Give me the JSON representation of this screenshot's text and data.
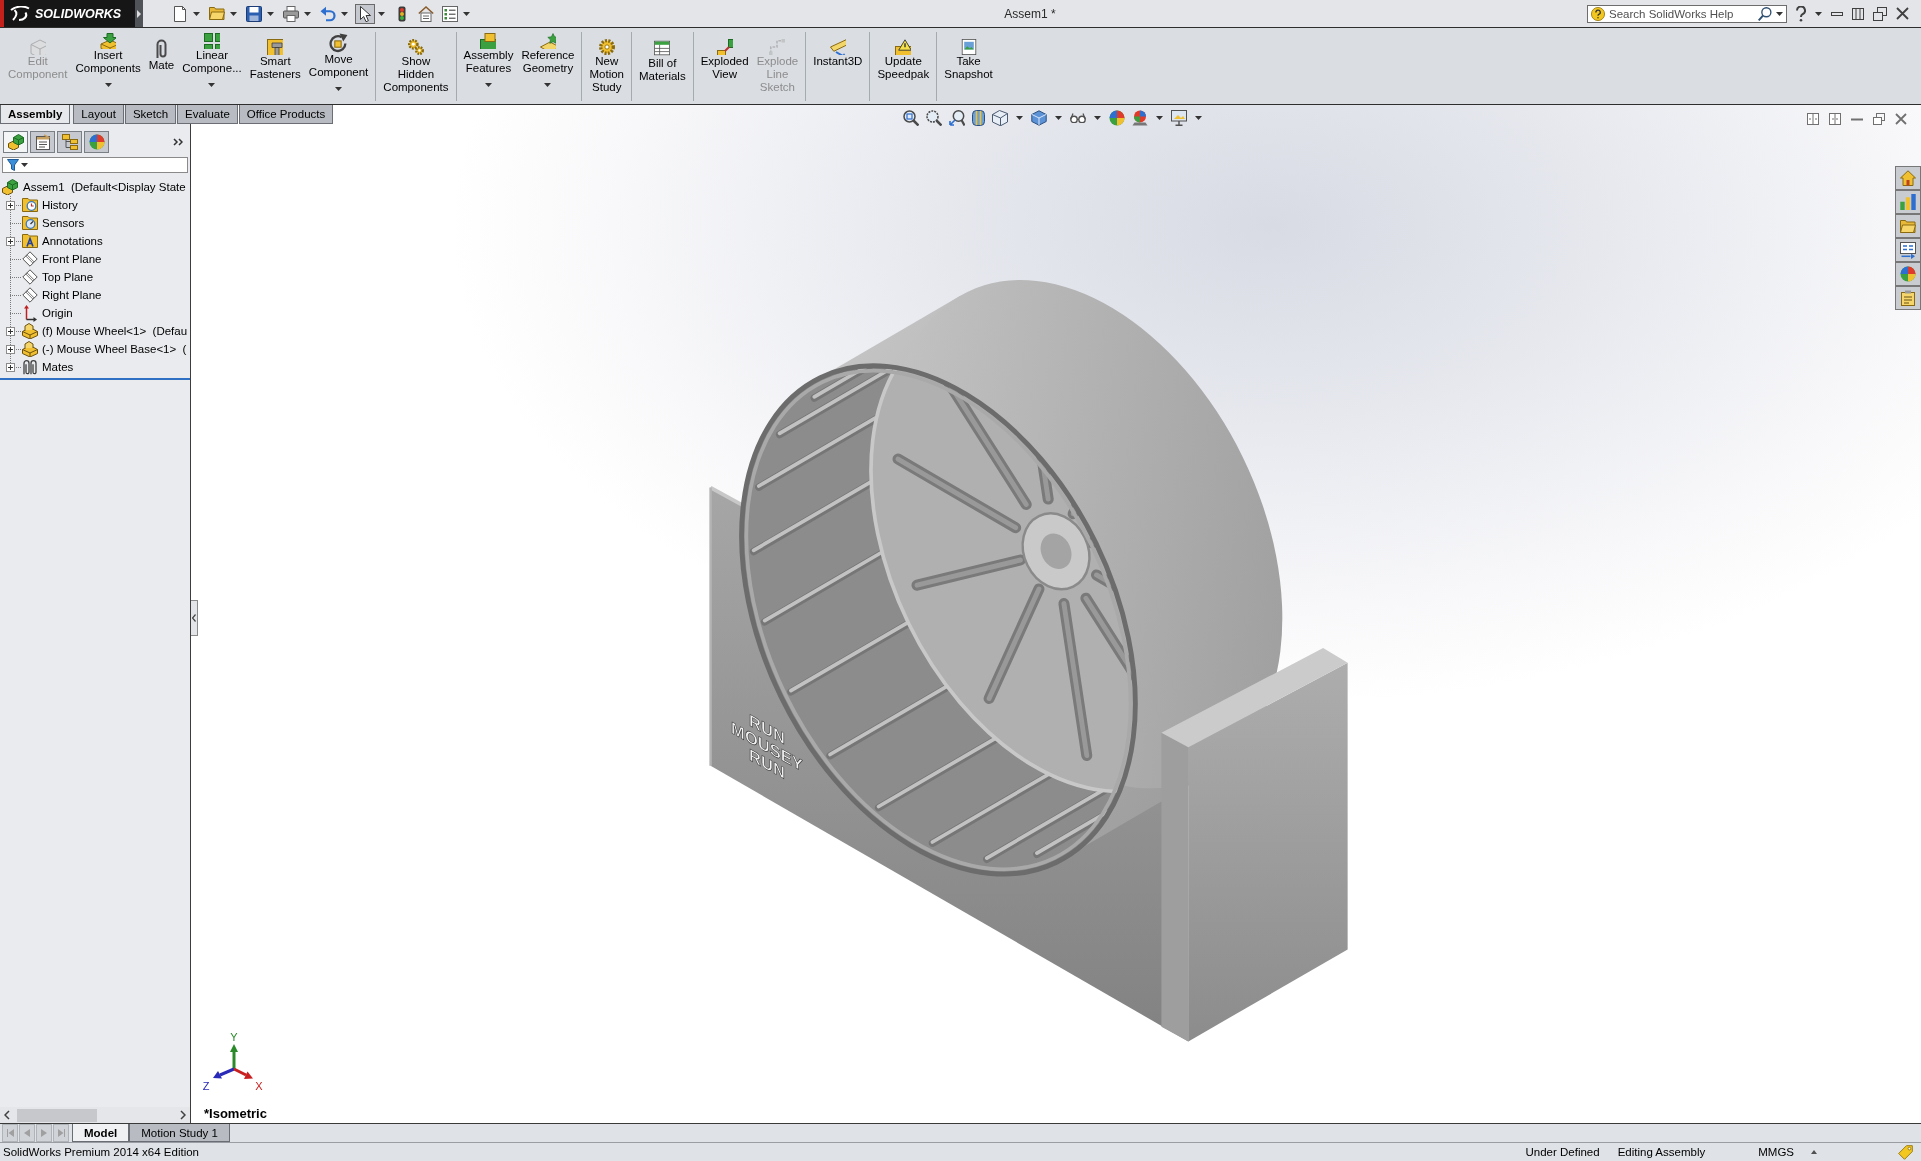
{
  "title_bar": {
    "logo": "SOLIDWORKS",
    "title": "Assem1 *",
    "search": {
      "placeholder": "Search SolidWorks Help"
    }
  },
  "quick_access": [
    {
      "pressed": false,
      "dropdown": true
    },
    {
      "pressed": false,
      "dropdown": true
    },
    {
      "pressed": false,
      "dropdown": true
    },
    {
      "pressed": false,
      "dropdown": true
    },
    {
      "pressed": false,
      "dropdown": true
    },
    {
      "pressed": true,
      "dropdown": true
    },
    {
      "pressed": false,
      "dropdown": false
    },
    {
      "pressed": false,
      "dropdown": false
    },
    {
      "pressed": false,
      "dropdown": true
    }
  ],
  "ribbon": {
    "groups": [
      [
        {
          "label": "Edit\nComponent",
          "disabled": true,
          "dropdown": false
        },
        {
          "label": "Insert\nComponents",
          "disabled": false,
          "dropdown": true
        },
        {
          "label": "Mate",
          "disabled": false,
          "dropdown": false
        },
        {
          "label": "Linear\nCompone...",
          "disabled": false,
          "dropdown": true
        },
        {
          "label": "Smart\nFasteners",
          "disabled": false,
          "dropdown": false
        },
        {
          "label": "Move\nComponent",
          "disabled": false,
          "dropdown": true
        }
      ],
      [
        {
          "label": "Show\nHidden\nComponents",
          "disabled": false,
          "dropdown": false
        }
      ],
      [
        {
          "label": "Assembly\nFeatures",
          "disabled": false,
          "dropdown": true
        },
        {
          "label": "Reference\nGeometry",
          "disabled": false,
          "dropdown": true
        }
      ],
      [
        {
          "label": "New\nMotion\nStudy",
          "disabled": false,
          "dropdown": false
        }
      ],
      [
        {
          "label": "Bill of\nMaterials",
          "disabled": false,
          "dropdown": false
        }
      ],
      [
        {
          "label": "Exploded\nView",
          "disabled": false,
          "dropdown": false
        },
        {
          "label": "Explode\nLine\nSketch",
          "disabled": true,
          "dropdown": false
        }
      ],
      [
        {
          "label": "Instant3D",
          "disabled": false,
          "dropdown": false
        }
      ],
      [
        {
          "label": "Update\nSpeedpak",
          "disabled": false,
          "dropdown": false
        }
      ],
      [
        {
          "label": "Take\nSnapshot",
          "disabled": false,
          "dropdown": false
        }
      ]
    ]
  },
  "ribbon_tabs": [
    {
      "label": "Assembly",
      "selected": true
    },
    {
      "label": "Layout",
      "selected": false
    },
    {
      "label": "Sketch",
      "selected": false
    },
    {
      "label": "Evaluate",
      "selected": false
    },
    {
      "label": "Office Products",
      "selected": false
    }
  ],
  "feature_manager": {
    "panel_tabs": [
      {
        "selected": true
      },
      {
        "selected": false
      },
      {
        "selected": false
      },
      {
        "selected": false
      }
    ],
    "tree": {
      "label": "Assem1  (Default<Display State",
      "children": [
        {
          "label": "History",
          "kind": "history",
          "expandable": true,
          "expanded": false
        },
        {
          "label": "Sensors",
          "kind": "sensors",
          "expandable": false
        },
        {
          "label": "Annotations",
          "kind": "annotations",
          "expandable": true,
          "expanded": false
        },
        {
          "label": "Front Plane",
          "kind": "plane",
          "expandable": false
        },
        {
          "label": "Top Plane",
          "kind": "plane",
          "expandable": false
        },
        {
          "label": "Right Plane",
          "kind": "plane",
          "expandable": false
        },
        {
          "label": "Origin",
          "kind": "origin",
          "expandable": false
        },
        {
          "label": "(f) Mouse Wheel<1>  (Defau",
          "kind": "component",
          "expandable": true,
          "expanded": false
        },
        {
          "label": "(-) Mouse Wheel Base<1>  (",
          "kind": "component",
          "expandable": true,
          "expanded": false
        },
        {
          "label": "Mates",
          "kind": "mates",
          "expandable": true,
          "expanded": false
        }
      ]
    }
  },
  "view_toolbar": [
    {
      "dropdown": false
    },
    {
      "dropdown": false
    },
    {
      "dropdown": false
    },
    {
      "dropdown": false
    },
    {
      "dropdown": true
    },
    {
      "dropdown": true
    },
    {
      "dropdown": true
    },
    {
      "dropdown": false
    },
    {
      "dropdown": true
    },
    {
      "dropdown": true
    }
  ],
  "viewport": {
    "engraving": "RUN\nMOUSEY\nRUN",
    "triad": {
      "y": "Y",
      "z": "Z",
      "x": "X"
    },
    "view_name": "*Isometric"
  },
  "bottom_tabs": [
    {
      "label": "Model",
      "selected": true
    },
    {
      "label": "Motion Study 1",
      "selected": false
    }
  ],
  "status_bar": {
    "edition": "SolidWorks Premium 2014 x64 Edition",
    "items": [
      "Under Defined",
      "Editing Assembly",
      "MMGS"
    ]
  }
}
